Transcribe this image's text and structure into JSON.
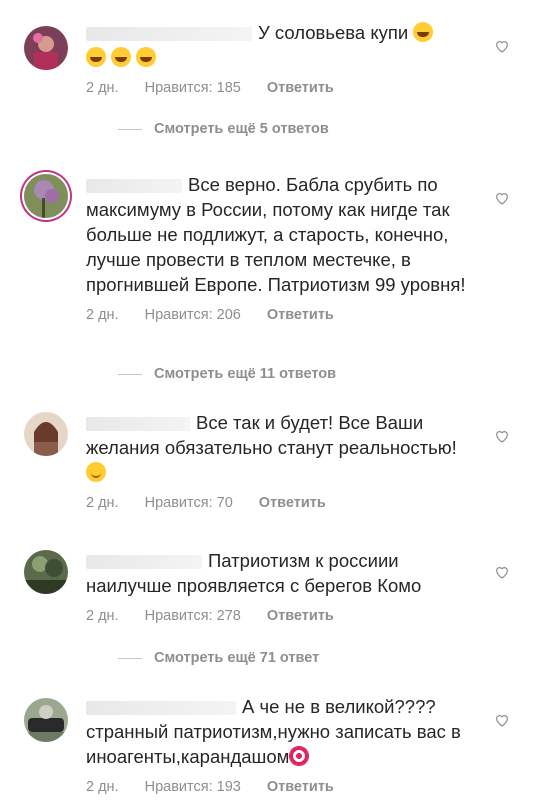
{
  "comments": [
    {
      "text": "У соловьева купи",
      "time": "2 дн.",
      "likes": "Нравится: 185",
      "reply": "Ответить",
      "more_replies": "Смотреть ещё 5 ответов"
    },
    {
      "text": "Все верно. Бабла срубить по максимуму в России, потому как нигде так больше не подлижут, а старость, конечно, лучше провести в теплом местечке, в прогнившей Европе. Патриотизм 99 уровня!",
      "time": "2 дн.",
      "likes": "Нравится: 206",
      "reply": "Ответить",
      "more_replies": "Смотреть ещё 11 ответов"
    },
    {
      "text": "Все так и будет! Все Ваши желания обязательно станут реальностью!",
      "time": "2 дн.",
      "likes": "Нравится: 70",
      "reply": "Ответить"
    },
    {
      "text": "Патриотизм к россиии наилучше проявляется с берегов Комо",
      "time": "2 дн.",
      "likes": "Нравится: 278",
      "reply": "Ответить",
      "more_replies": "Смотреть ещё 71 ответ"
    },
    {
      "text": "А че не в великой???? странный патриотизм,нужно записать вас в иноагенты,карандашом",
      "time": "2 дн.",
      "likes": "Нравится: 193",
      "reply": "Ответить"
    }
  ],
  "icons": {
    "like": "heart-outline-icon",
    "emoji_laugh": "face-with-tears-of-joy",
    "emoji_smile": "smiling-face",
    "emoji_target": "direct-hit"
  },
  "colors": {
    "text": "#262626",
    "secondary": "#8e8e8e",
    "story_ring": "#c13584"
  }
}
